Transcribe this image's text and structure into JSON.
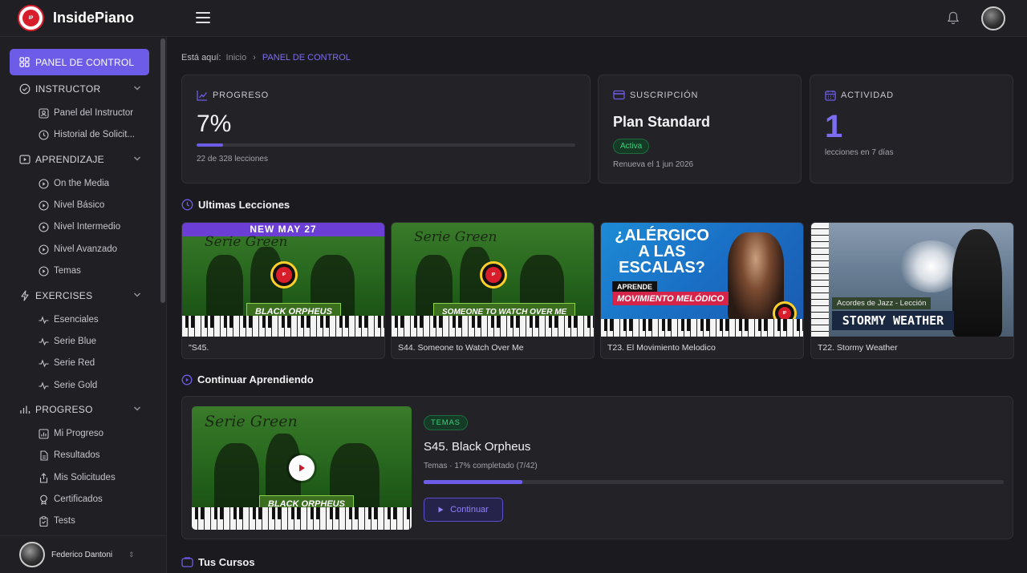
{
  "app": {
    "name": "InsidePiano"
  },
  "sidebar": {
    "active": "PANEL DE CONTROL",
    "sections": [
      {
        "title": "INSTRUCTOR",
        "items": [
          "Panel del Instructor",
          "Historial de Solicit..."
        ]
      },
      {
        "title": "APRENDIZAJE",
        "items": [
          "On the Media",
          "Nivel Básico",
          "Nivel Intermedio",
          "Nivel Avanzado",
          "Temas"
        ]
      },
      {
        "title": "EXERCISES",
        "items": [
          "Esenciales",
          "Serie Blue",
          "Serie Red",
          "Serie Gold"
        ]
      },
      {
        "title": "PROGRESO",
        "items": [
          "Mi Progreso",
          "Resultados",
          "Mis Solicitudes",
          "Certificados",
          "Tests"
        ]
      }
    ],
    "user": {
      "name": "Federico Dantoni"
    }
  },
  "breadcrumb": {
    "prefix": "Está aquí:",
    "home": "Inicio",
    "current": "PANEL DE CONTROL"
  },
  "stats": {
    "progress": {
      "label": "PROGRESO",
      "value": "7%",
      "fraction": 0.07,
      "detail": "22 de 328 lecciones"
    },
    "subscription": {
      "label": "SUSCRIPCIÓN",
      "plan": "Plan Standard",
      "status": "Activa",
      "renew": "Renueva el 1 jun 2026"
    },
    "activity": {
      "label": "ACTIVIDAD",
      "value": "1",
      "detail": "lecciones en 7 días"
    }
  },
  "latest": {
    "title": "Ultimas Lecciones",
    "lessons": [
      {
        "caption": "\"S45.",
        "banner": "NEW MAY 27",
        "script": "Serie Green",
        "tag": "BLACK ORPHEUS"
      },
      {
        "caption": "S44. Someone to Watch Over Me",
        "script": "Serie Green",
        "tag": "SOMEONE TO WATCH OVER ME"
      },
      {
        "caption": "T23. El Movimiento Melodico",
        "headline": "¿ALÉRGICO A LAS ESCALAS?",
        "sub1": "APRENDE",
        "sub2": "MOVIMIENTO MELÓDICO"
      },
      {
        "caption": "T22. Stormy Weather",
        "small": "Acordes de Jazz - Lección",
        "headline": "STORMY WEATHER"
      }
    ]
  },
  "continue": {
    "title": "Continuar Aprendiendo",
    "badge": "TEMAS",
    "lesson": "S45. Black Orpheus",
    "sub": "Temas · 17% completado (7/42)",
    "fraction": 0.17,
    "button": "Continuar",
    "thumb_script": "Serie Green",
    "thumb_tag": "BLACK ORPHEUS"
  },
  "courses": {
    "title": "Tus Cursos"
  },
  "colors": {
    "accent": "#6d5ce8",
    "success": "#39d27b",
    "background": "#1b1b1f"
  }
}
